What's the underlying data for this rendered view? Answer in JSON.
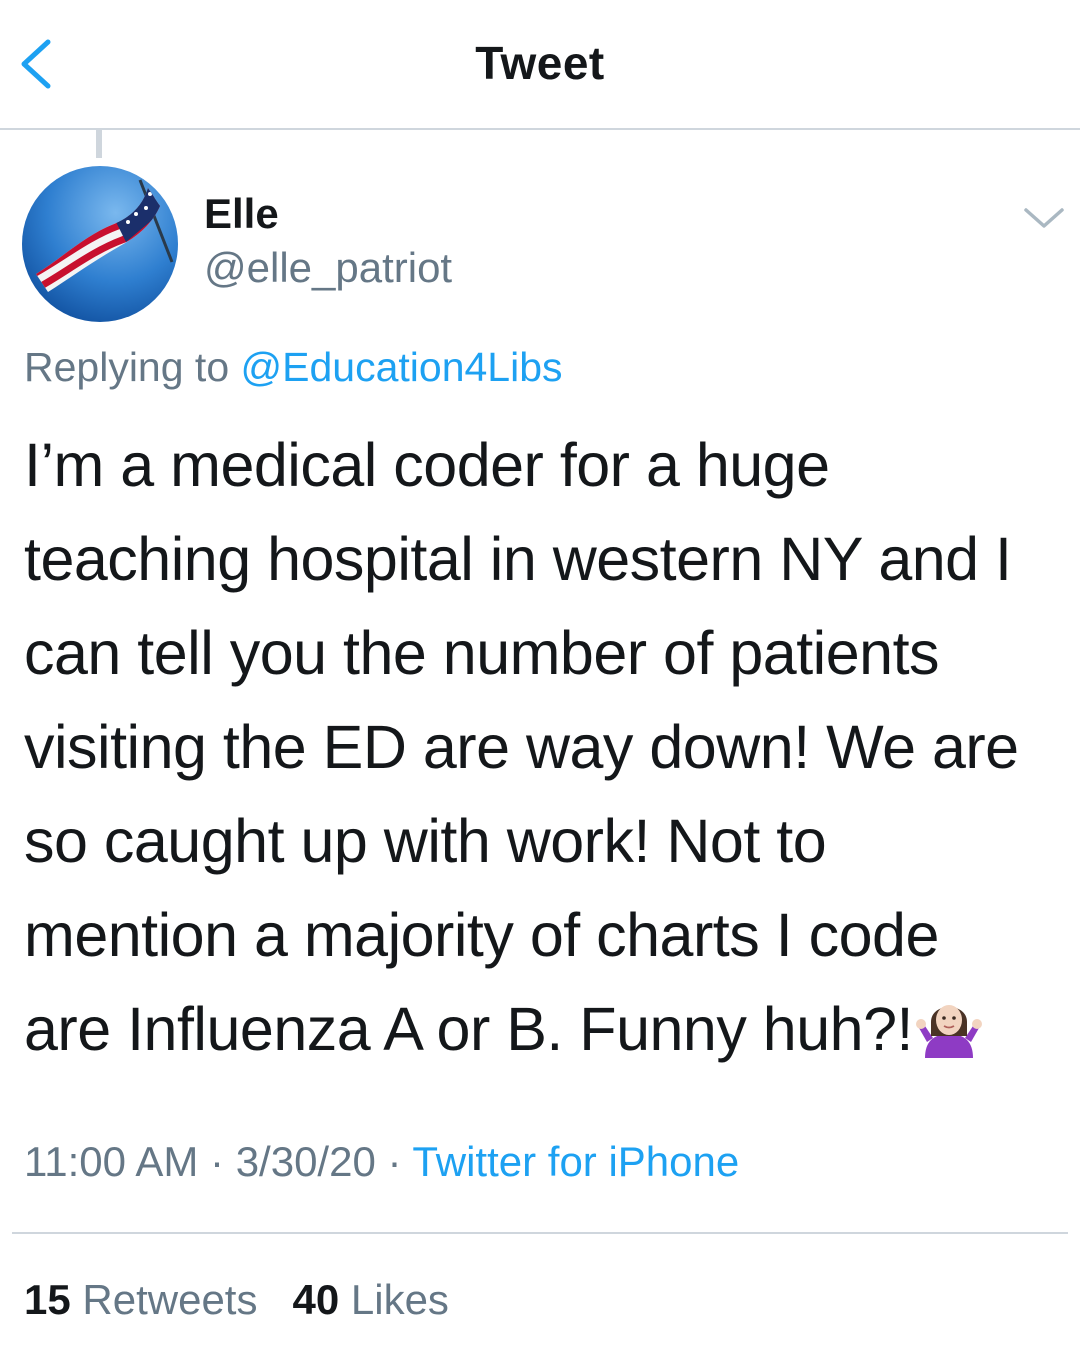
{
  "header": {
    "title": "Tweet",
    "back_icon": "chevron-left-icon"
  },
  "colors": {
    "accent": "#1da1f2",
    "secondary_text": "#657786",
    "primary_text": "#14171a",
    "divider": "#cfd6dd"
  },
  "tweet": {
    "author_name": "Elle",
    "author_handle": "@elle_patriot",
    "avatar_icon": "american-flag-avatar",
    "menu_icon": "chevron-down-icon",
    "replying_prefix": "Replying to",
    "replying_to": "@Education4Libs",
    "text_lines": [
      "I’m a medical coder for a huge",
      "teaching hospital in western NY and I",
      "can tell you the number of patients",
      "visiting the ED are way down! We are",
      "so caught up with work! Not to",
      "mention a majority of charts I code",
      "are Influenza A or B. Funny huh?!"
    ],
    "emoji_icon": "woman-shrugging-emoji",
    "time": "11:00 AM",
    "date": "3/30/20",
    "separator": "·",
    "source": "Twitter for iPhone"
  },
  "stats": {
    "retweets_count": "15",
    "retweets_label": "Retweets",
    "likes_count": "40",
    "likes_label": "Likes"
  }
}
